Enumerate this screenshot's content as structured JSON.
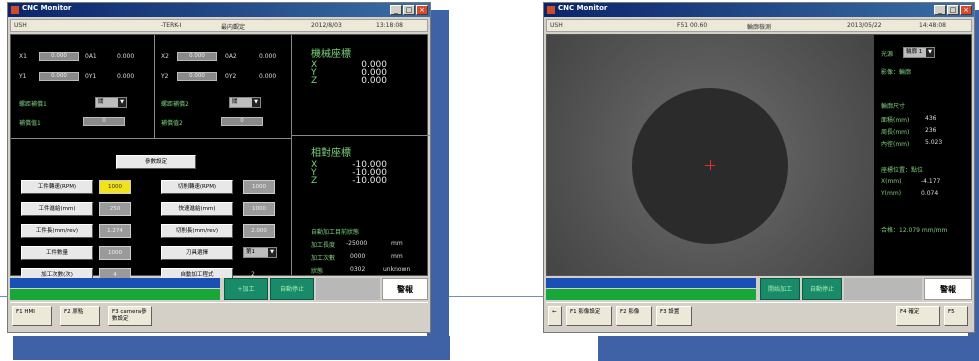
{
  "screen1": {
    "title": "CNC Monitor",
    "info": [
      "USH",
      "-TERK-I",
      "最内觀定",
      "2012/8/03",
      "13:18:08"
    ],
    "top_rows": [
      {
        "r1a": "X1",
        "f1": "0.000",
        "r1b": "0A1",
        "v1": "0.000",
        "r1c": "X2",
        "f2": "0.000",
        "r1d": "0A2",
        "v2": "0.000"
      },
      {
        "r1a": "Y1",
        "f1": "0.000",
        "r1b": "0Y1",
        "v1": "0.000",
        "r1c": "Y2",
        "f2": "0.000",
        "r1d": "0Y2",
        "v2": "0.000"
      }
    ],
    "param_left": [
      {
        "label": "螺距補償1",
        "value": "關"
      },
      {
        "label": "補償值1",
        "value": "0"
      }
    ],
    "param_right": [
      {
        "label": "螺距補償2",
        "value": "關"
      },
      {
        "label": "補償值2",
        "value": "0"
      }
    ],
    "mech_title": "機械座標",
    "mech_axes": [
      "X",
      "Y",
      "Z"
    ],
    "mech_values": [
      "0.000",
      "0.000",
      "0.000"
    ],
    "rel_title": "相對座標",
    "rel_axes": [
      "X",
      "Y",
      "Z"
    ],
    "rel_values": [
      "-10.000",
      "-10.000",
      "-10.000"
    ],
    "param_header": "參數設定",
    "param_buttons": [
      {
        "left": "工件轉速(RPM)",
        "lv": "1000",
        "right": "切削轉速(RPM)",
        "rv": "1000"
      },
      {
        "left": "工件進給(mm)",
        "lv": "250",
        "right": "快速進給(mm)",
        "rv": "1000"
      },
      {
        "left": "工件長(mm/rev)",
        "lv": "1.274",
        "right": "切削長(mm/rev)",
        "rv": "2.000"
      },
      {
        "left": "工件數量",
        "lv": "1000",
        "right": "刀具選擇",
        "rv": "第1"
      },
      {
        "left": "加工次數(次)",
        "lv": "4",
        "right": "自動加工程式",
        "rv": "2"
      }
    ],
    "status_title": "自動加工目前狀態",
    "status_rows": [
      {
        "label": "加工長度",
        "value": "-25000",
        "unit": "mm"
      },
      {
        "label": "加工次數",
        "value": "0000",
        "unit": "mm"
      },
      {
        "label": "狀態",
        "value": "0302",
        "unit": "unknown"
      }
    ],
    "run_button": "+加工",
    "stop_button": "自動停止",
    "alarm": "警報",
    "footer": [
      "F1 HMI",
      "F2 原點",
      "F3 camera參數設定"
    ]
  },
  "screen2": {
    "title": "CNC Monitor",
    "info": [
      "USH",
      "F51 00.60",
      "輪廓檢測",
      "2013/05/22",
      "14:48:08"
    ],
    "side_mode_label": "光源",
    "side_mode_value": "輪廓 1",
    "side_sub": "影像：輪廓",
    "side_meas_title": "輪廓尺寸",
    "side_meas": [
      {
        "label": "面積(mm)",
        "value": "436"
      },
      {
        "label": "周長(mm)",
        "value": "236"
      },
      {
        "label": "內徑(mm)",
        "value": "5.023"
      }
    ],
    "side_coord_title": "座標位置：點位",
    "side_coords": [
      {
        "label": "X(mm)",
        "value": "-4.177"
      },
      {
        "label": "Y(mm)",
        "value": "0.074"
      }
    ],
    "side_result": "合格：12.079  mm/mm",
    "run_button": "開始加工",
    "stop_button": "自動停止",
    "alarm": "警報",
    "footer": [
      "F1 影像設定",
      "F2 影像",
      "F3 設置"
    ],
    "footer_right": [
      "F4 確定",
      "F5"
    ]
  }
}
